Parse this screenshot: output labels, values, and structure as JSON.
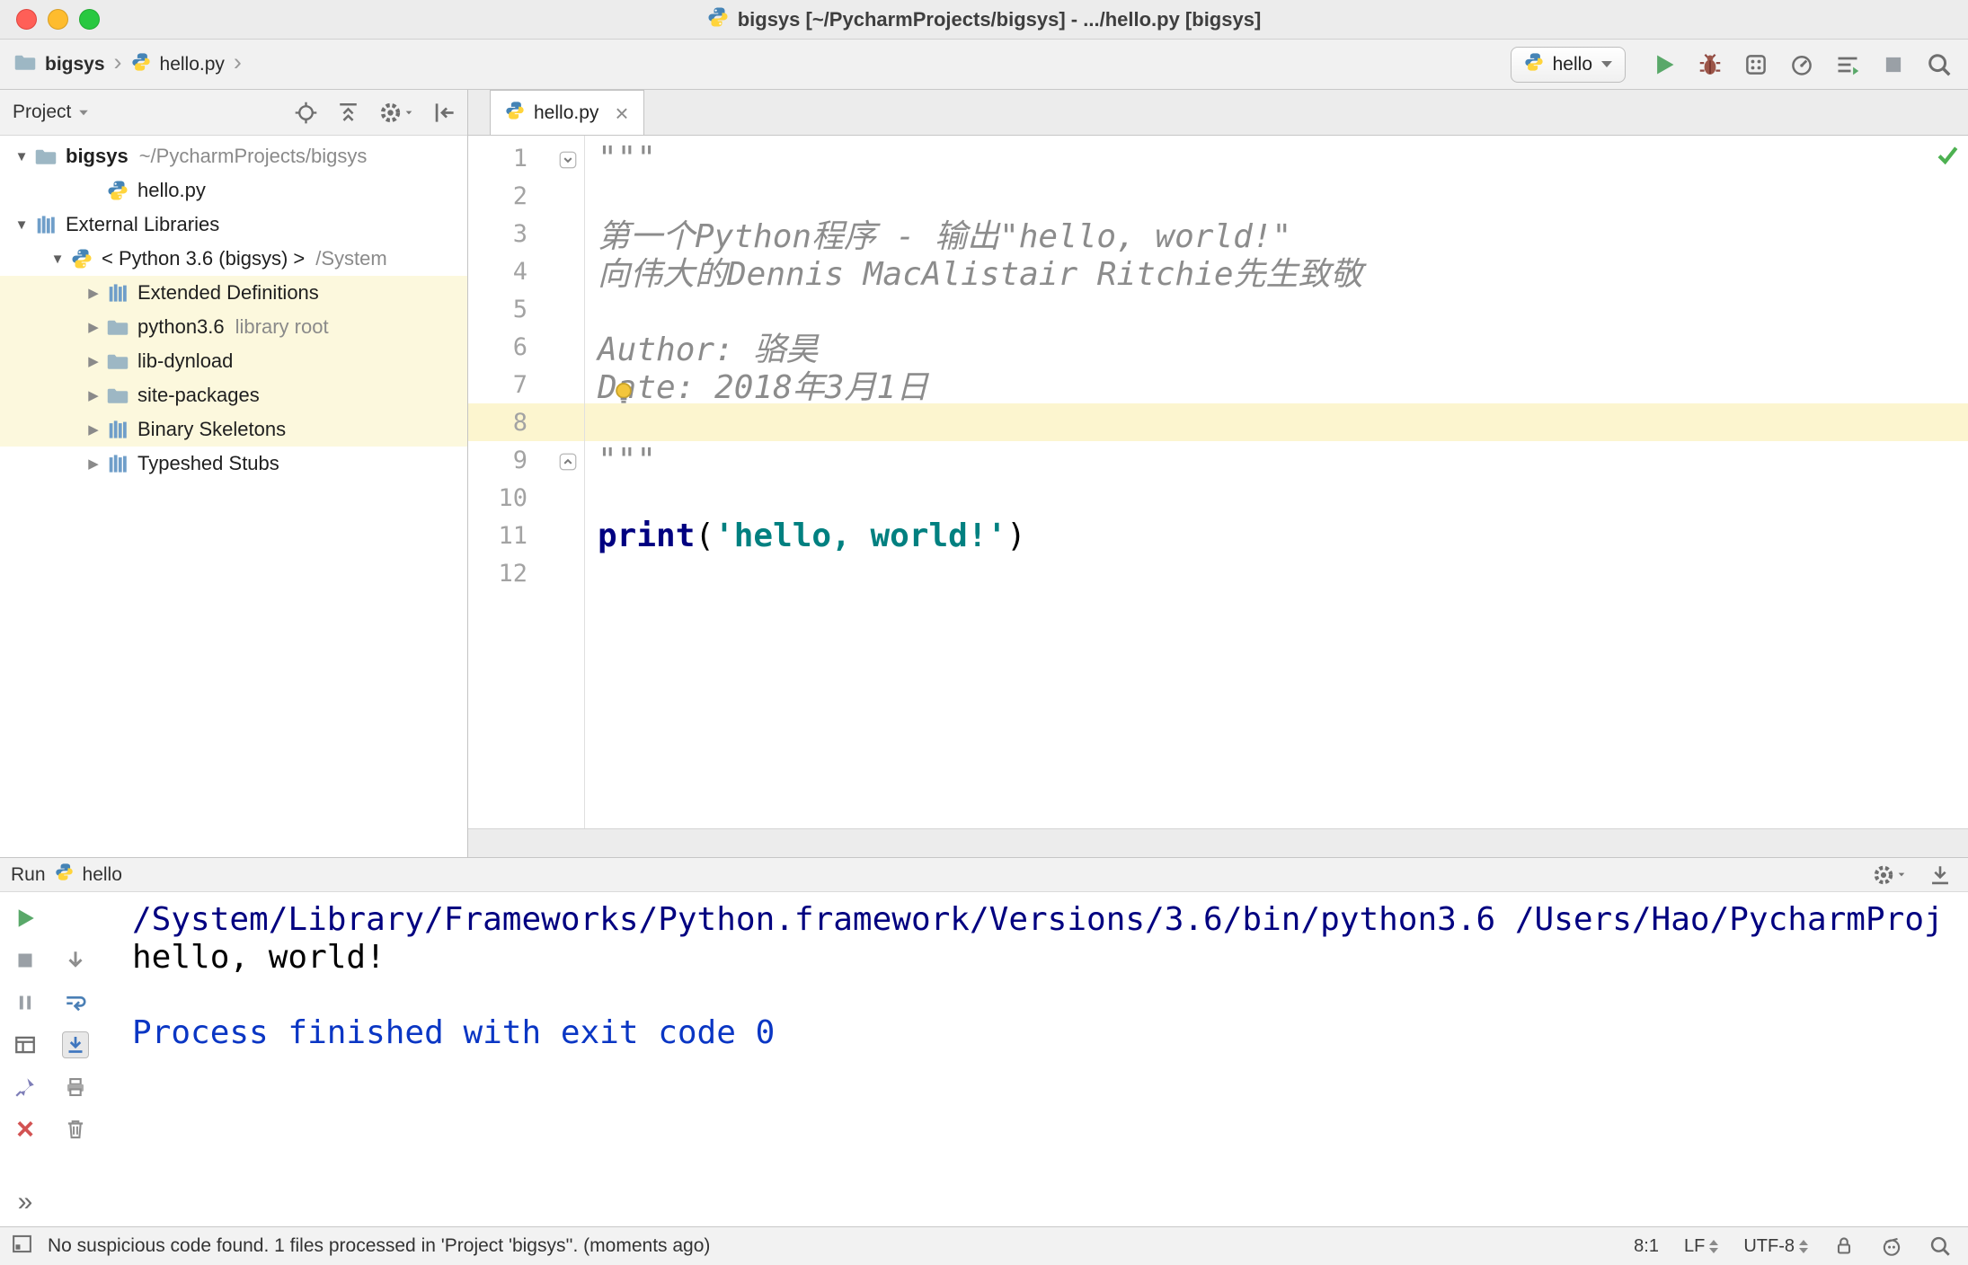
{
  "colors": {
    "caret_line_highlight": "#fcf5cf",
    "tree_highlight": "#fcf8dd",
    "keyword": "#000080",
    "string": "#008080",
    "docstring": "#8c8c8c",
    "console_path": "#000080",
    "console_info": "#0a36c4",
    "run_green": "#59a869"
  },
  "titlebar": {
    "title": "bigsys [~/PycharmProjects/bigsys] - .../hello.py [bigsys]"
  },
  "toolbar": {
    "breadcrumbs": [
      "bigsys",
      "hello.py"
    ],
    "run_config": "hello"
  },
  "project": {
    "header": "Project",
    "tree": [
      {
        "label": "bigsys",
        "suffix": "~/PycharmProjects/bigsys",
        "icon": "folder",
        "arrow": "down",
        "indent": 0,
        "bold": true
      },
      {
        "label": "hello.py",
        "icon": "python",
        "arrow": "none",
        "indent": 2
      },
      {
        "label": "External Libraries",
        "icon": "library",
        "arrow": "down",
        "indent": 0
      },
      {
        "label": "< Python 3.6 (bigsys) >",
        "suffix": "/System",
        "icon": "python",
        "arrow": "down",
        "indent": 1
      },
      {
        "label": "Extended Definitions",
        "icon": "library",
        "arrow": "right",
        "indent": 2,
        "highlight": true
      },
      {
        "label": "python3.6",
        "suffix": "library root",
        "icon": "folder",
        "arrow": "right",
        "indent": 2,
        "highlight": true
      },
      {
        "label": "lib-dynload",
        "icon": "folder",
        "arrow": "right",
        "indent": 2,
        "highlight": true
      },
      {
        "label": "site-packages",
        "icon": "folder",
        "arrow": "right",
        "indent": 2,
        "highlight": true
      },
      {
        "label": "Binary Skeletons",
        "icon": "library",
        "arrow": "right",
        "indent": 2,
        "highlight": true
      },
      {
        "label": "Typeshed Stubs",
        "icon": "library",
        "arrow": "right",
        "indent": 2
      }
    ]
  },
  "editor": {
    "tab": "hello.py",
    "current_line": 8,
    "lines": [
      {
        "n": 1,
        "fold": "start",
        "segs": [
          {
            "t": "\"\"\"",
            "s": "doc"
          }
        ]
      },
      {
        "n": 2,
        "segs": []
      },
      {
        "n": 3,
        "segs": [
          {
            "t": "第一个Python程序 - 输出\"hello, world!\"",
            "s": "doc"
          }
        ]
      },
      {
        "n": 4,
        "segs": [
          {
            "t": "向伟大的Dennis MacAlistair Ritchie先生致敬",
            "s": "doc"
          }
        ]
      },
      {
        "n": 5,
        "segs": []
      },
      {
        "n": 6,
        "segs": [
          {
            "t": "Author: 骆昊",
            "s": "doc"
          }
        ]
      },
      {
        "n": 7,
        "segs": [
          {
            "t": "Date: 2018年3月1日",
            "s": "doc"
          }
        ]
      },
      {
        "n": 8,
        "segs": []
      },
      {
        "n": 9,
        "fold": "end",
        "segs": [
          {
            "t": "\"\"\"",
            "s": "doc"
          }
        ]
      },
      {
        "n": 10,
        "segs": []
      },
      {
        "n": 11,
        "segs": [
          {
            "t": "print",
            "s": "kw"
          },
          {
            "t": "(",
            "s": "pln"
          },
          {
            "t": "'hello, world!'",
            "s": "str"
          },
          {
            "t": ")",
            "s": "pln"
          }
        ]
      },
      {
        "n": 12,
        "segs": []
      }
    ]
  },
  "run": {
    "title": "Run",
    "config": "hello",
    "console": [
      {
        "t": "/System/Library/Frameworks/Python.framework/Versions/3.6/bin/python3.6 /Users/Hao/PycharmProj",
        "s": "path"
      },
      {
        "t": "hello, world!",
        "s": "pln"
      },
      {
        "t": "",
        "s": "pln"
      },
      {
        "t": "Process finished with exit code 0",
        "s": "info"
      }
    ]
  },
  "statusbar": {
    "message": "No suspicious code found. 1 files processed in 'Project 'bigsys''. (moments ago)",
    "caret_position": "8:1",
    "line_separator": "LF",
    "encoding": "UTF-8"
  }
}
